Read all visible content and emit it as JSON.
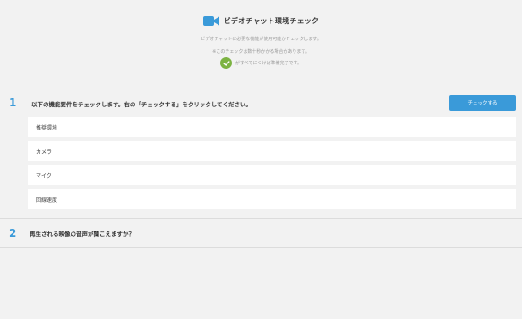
{
  "header": {
    "title": "ビデオチャット環境チェック",
    "subtitle1": "ビデオチャットに必要な機能が使用可能かチェックします。",
    "subtitle2": "※このチェックは数十秒かかる場合があります。",
    "check_note": "がすべてにつけば準備完了です。",
    "camera_icon": "video-camera-icon",
    "check_icon": "check-circle-icon"
  },
  "step1": {
    "number": "1",
    "text": "以下の機能要件をチェックします。右の「チェックする」をクリックしてください。",
    "button_label": "チェックする",
    "items": [
      "推奨環境",
      "カメラ",
      "マイク",
      "回線速度"
    ]
  },
  "step2": {
    "number": "2",
    "text": "再生される映像の音声が聞こえますか？"
  },
  "colors": {
    "accent": "#3a9ad9",
    "check_green": "#7cb342",
    "background": "#f2f2f2"
  }
}
